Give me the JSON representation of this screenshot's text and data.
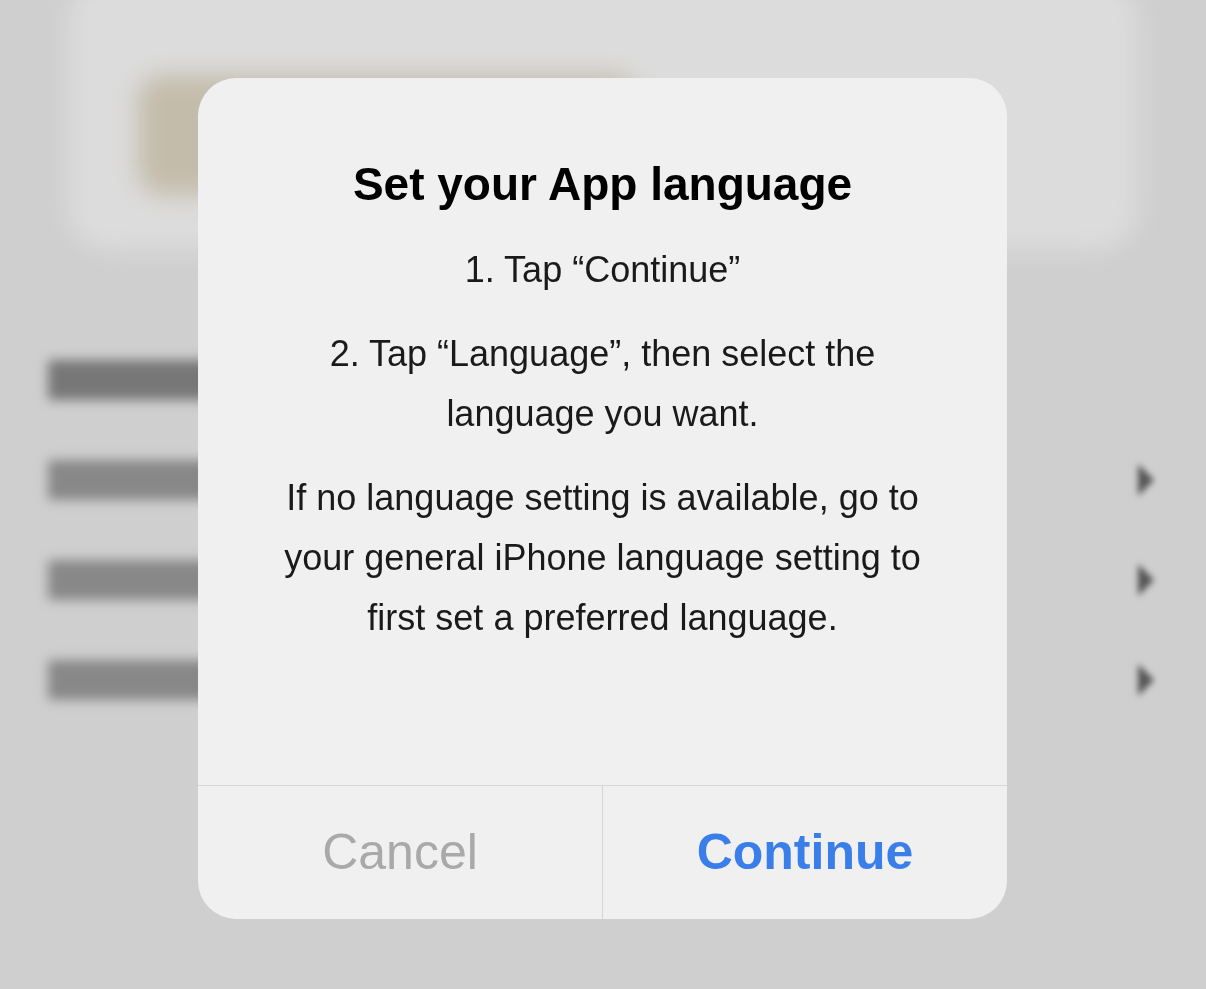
{
  "dialog": {
    "title": "Set your App language",
    "paragraphs": [
      "1. Tap “Continue”",
      "2. Tap “Language”, then select the language you want.",
      "If no language setting is available, go to your general iPhone language setting to first set a preferred language."
    ],
    "buttons": [
      {
        "label": "Cancel",
        "kind": "cancel"
      },
      {
        "label": "Continue",
        "kind": "primary"
      }
    ]
  }
}
